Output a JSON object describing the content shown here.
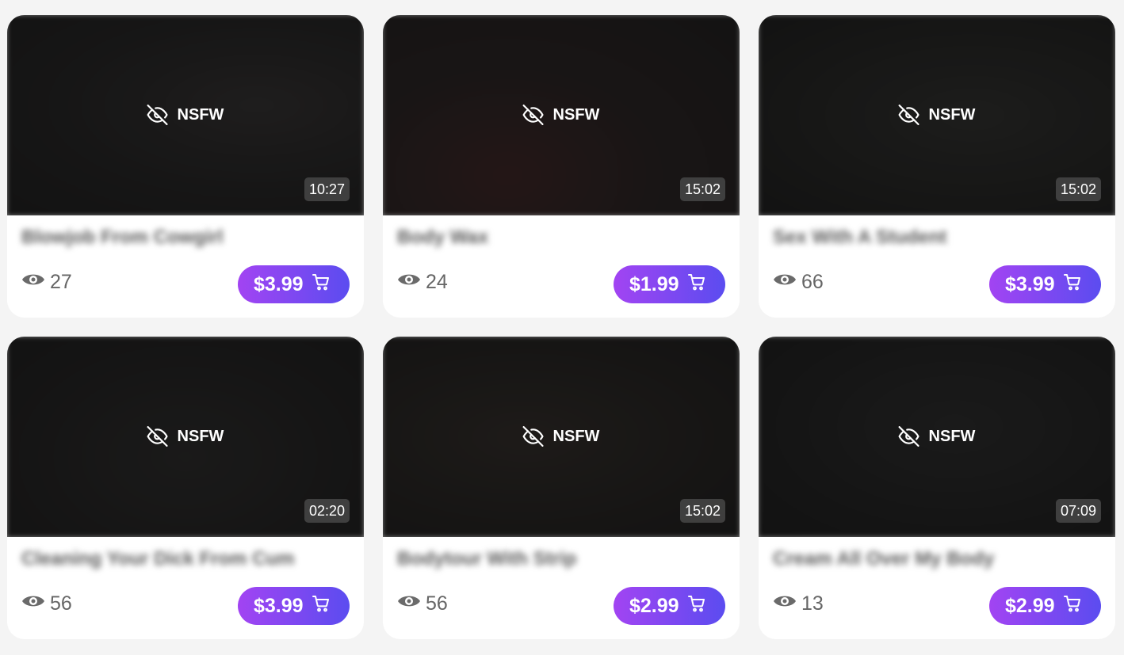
{
  "nsfw_label": "NSFW",
  "colors": {
    "page_bg": "#f4f4f4",
    "card_bg": "#ffffff",
    "button_gradient_start": "#a244f2",
    "button_gradient_end": "#5b4cf0"
  },
  "icons": {
    "hidden": "eye-off-icon",
    "views": "eye-icon",
    "cart": "cart-icon"
  },
  "videos": [
    {
      "title": "Blowjob From Cowgirl",
      "duration": "10:27",
      "views": "27",
      "price": "$3.99"
    },
    {
      "title": "Body Wax",
      "duration": "15:02",
      "views": "24",
      "price": "$1.99"
    },
    {
      "title": "Sex With A Student",
      "duration": "15:02",
      "views": "66",
      "price": "$3.99"
    },
    {
      "title": "Cleaning Your Dick From Cum",
      "duration": "02:20",
      "views": "56",
      "price": "$3.99"
    },
    {
      "title": "Bodytour With Strip",
      "duration": "15:02",
      "views": "56",
      "price": "$2.99"
    },
    {
      "title": "Cream All Over My Body",
      "duration": "07:09",
      "views": "13",
      "price": "$2.99"
    }
  ]
}
